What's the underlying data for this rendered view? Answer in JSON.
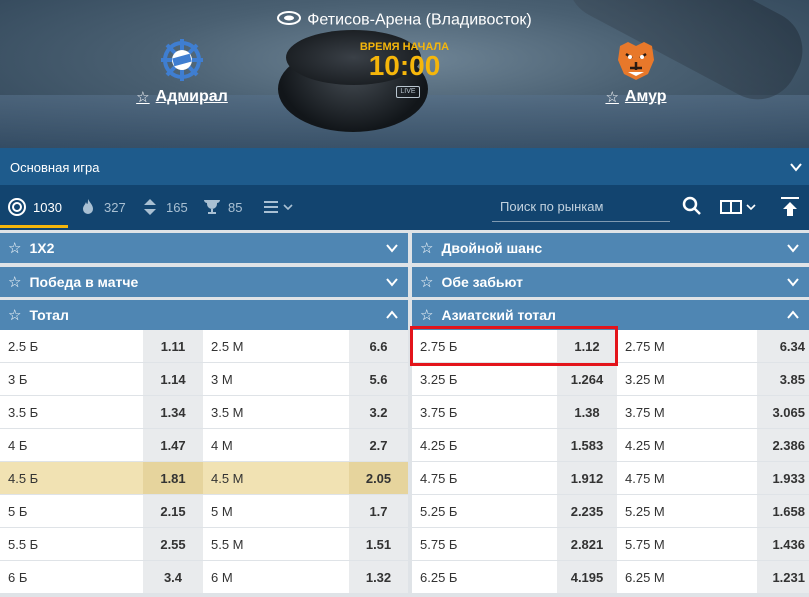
{
  "header": {
    "arena": "Фетисов-Арена (Владивосток)",
    "start_label": "ВРЕМЯ НАЧАЛА",
    "start_time": "10:00",
    "live_label": "LIVE",
    "home_team": "Адмирал",
    "away_team": "Амур"
  },
  "main_game": "Основная игра",
  "filters": {
    "all_count": "1030",
    "hot_count": "327",
    "sort_count": "165",
    "cup_count": "85",
    "search_placeholder": "Поиск по рынкам"
  },
  "markets": {
    "m1x2": "1X2",
    "double_chance": "Двойной шанс",
    "match_win": "Победа в матче",
    "both_score": "Обе забьют",
    "total": "Тотал",
    "asian_total": "Азиатский тотал"
  },
  "total_rows": [
    {
      "over": "2.5 Б",
      "over_odd": "1.11",
      "under": "2.5 М",
      "under_odd": "6.6"
    },
    {
      "over": "3 Б",
      "over_odd": "1.14",
      "under": "3 М",
      "under_odd": "5.6"
    },
    {
      "over": "3.5 Б",
      "over_odd": "1.34",
      "under": "3.5 М",
      "under_odd": "3.2"
    },
    {
      "over": "4 Б",
      "over_odd": "1.47",
      "under": "4 М",
      "under_odd": "2.7"
    },
    {
      "over": "4.5 Б",
      "over_odd": "1.81",
      "under": "4.5 М",
      "under_odd": "2.05"
    },
    {
      "over": "5 Б",
      "over_odd": "2.15",
      "under": "5 М",
      "under_odd": "1.7"
    },
    {
      "over": "5.5 Б",
      "over_odd": "2.55",
      "under": "5.5 М",
      "under_odd": "1.51"
    },
    {
      "over": "6 Б",
      "over_odd": "3.4",
      "under": "6 М",
      "under_odd": "1.32"
    }
  ],
  "asian_rows": [
    {
      "over": "2.75 Б",
      "over_odd": "1.12",
      "under": "2.75 М",
      "under_odd": "6.34"
    },
    {
      "over": "3.25 Б",
      "over_odd": "1.264",
      "under": "3.25 М",
      "under_odd": "3.85"
    },
    {
      "over": "3.75 Б",
      "over_odd": "1.38",
      "under": "3.75 М",
      "under_odd": "3.065"
    },
    {
      "over": "4.25 Б",
      "over_odd": "1.583",
      "under": "4.25 М",
      "under_odd": "2.386"
    },
    {
      "over": "4.75 Б",
      "over_odd": "1.912",
      "under": "4.75 М",
      "under_odd": "1.933"
    },
    {
      "over": "5.25 Б",
      "over_odd": "2.235",
      "under": "5.25 М",
      "under_odd": "1.658"
    },
    {
      "over": "5.75 Б",
      "over_odd": "2.821",
      "under": "5.75 М",
      "under_odd": "1.436"
    },
    {
      "over": "6.25 Б",
      "over_odd": "4.195",
      "under": "6.25 М",
      "under_odd": "1.231"
    }
  ],
  "colors": {
    "accent": "#f5b60b",
    "highlight": "#e3141b"
  }
}
